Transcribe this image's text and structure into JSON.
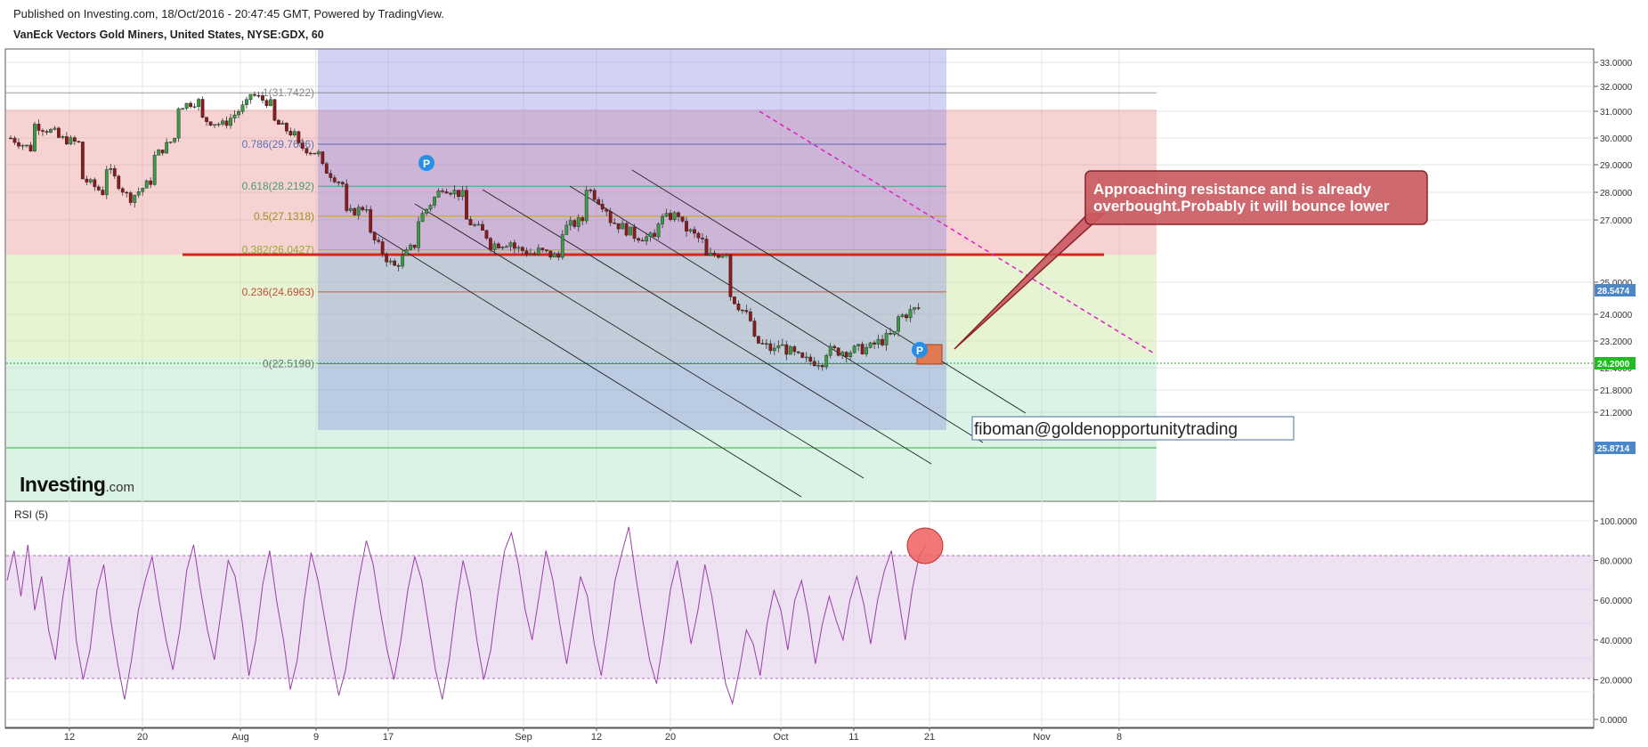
{
  "header": {
    "published": "Published on Investing.com, 18/Oct/2016 - 20:47:45 GMT, Powered by TradingView.",
    "symbol": "VanEck Vectors Gold Miners, United States, NYSE:GDX, 60"
  },
  "logo": {
    "brand": "Investing",
    "suffix": ".com"
  },
  "colors": {
    "bull": "#3a9a45",
    "bear": "#8b1a1a",
    "rsi": "#9b3ea8",
    "resistance": "#d7261e",
    "trend_dashed": "#e020c0",
    "channel": "#222222",
    "fib_box": "#8080e0"
  },
  "chart_data": [
    {
      "type": "candlestick",
      "title": "VanEck Vectors Gold Miners, United States, NYSE:GDX, 60",
      "x_ticks": [
        "12",
        "20",
        "Aug",
        "9",
        "17",
        "Sep",
        "12",
        "20",
        "Oct",
        "11",
        "21",
        "Nov",
        "8"
      ],
      "y_ticks": [
        "33.0000",
        "32.0000",
        "31.0000",
        "30.0000",
        "29.0000",
        "28.0000",
        "27.0000",
        "25.0000",
        "24.0000",
        "23.2000",
        "22.4000",
        "21.8000",
        "21.2000"
      ],
      "price_labels": [
        "28.5474",
        "24.2000",
        "25.8714"
      ],
      "y_range": [
        20.8,
        33.6
      ],
      "grid": true,
      "fibonacci": [
        {
          "label": "1(31.7422)",
          "level": 31.7422
        },
        {
          "label": "0.786(29.7686)",
          "level": 29.7686
        },
        {
          "label": "0.618(28.2192)",
          "level": 28.2192
        },
        {
          "label": "0.5(27.1318)",
          "level": 27.1318
        },
        {
          "label": "0.382(26.0427)",
          "level": 26.0427
        },
        {
          "label": "0.236(24.6963)",
          "level": 24.6963
        },
        {
          "label": "0(22.5198)",
          "level": 22.5198
        }
      ],
      "annotations": [
        {
          "text": "Approaching resistance and is already overbought.Probably it will bounce lower"
        },
        {
          "text": "fiboman@goldenopportunitytrading"
        },
        {
          "text": "P"
        },
        {
          "text": "P"
        }
      ],
      "close_path": [
        [
          30.0,
          29.6
        ],
        [
          30.5,
          30.2
        ],
        [
          30.0,
          29.8
        ],
        [
          28.5,
          28.0
        ],
        [
          28.9,
          27.9
        ],
        [
          27.8,
          28.4
        ],
        [
          29.3,
          30.0
        ],
        [
          31.2,
          31.4
        ],
        [
          30.7,
          30.5
        ],
        [
          30.6,
          31.3
        ],
        [
          31.7,
          31.3
        ],
        [
          30.6,
          30.1
        ],
        [
          29.7,
          29.4
        ],
        [
          28.9,
          28.3
        ],
        [
          27.2,
          27.5
        ],
        [
          26.5,
          25.6
        ],
        [
          25.5,
          26.2
        ],
        [
          27.0,
          28.0
        ],
        [
          28.2,
          27.9
        ],
        [
          27.0,
          26.5
        ],
        [
          26.2,
          26.3
        ],
        [
          26.1,
          25.9
        ],
        [
          26.0,
          25.8
        ],
        [
          26.7,
          27.0
        ],
        [
          28.2,
          27.4
        ],
        [
          27.0,
          26.6
        ],
        [
          26.5,
          26.4
        ],
        [
          27.0,
          27.2
        ],
        [
          26.8,
          26.3
        ],
        [
          25.8,
          26.0
        ],
        [
          24.6,
          23.8
        ],
        [
          23.2,
          22.9
        ],
        [
          23.1,
          22.7
        ],
        [
          22.6,
          22.6
        ],
        [
          22.9,
          22.9
        ],
        [
          22.9,
          23.0
        ],
        [
          23.1,
          23.4
        ],
        [
          23.9,
          24.2
        ]
      ]
    },
    {
      "type": "line",
      "title": "RSI (5)",
      "y_ticks": [
        "100.0000",
        "80.0000",
        "60.0000",
        "40.0000",
        "20.0000",
        "0.0000"
      ],
      "y_range": [
        0,
        100
      ],
      "levels": [
        80,
        20
      ],
      "series": [
        {
          "values": [
            70,
            85,
            62,
            88,
            55,
            72,
            45,
            30,
            60,
            82,
            40,
            20,
            35,
            65,
            78,
            50,
            28,
            10,
            30,
            55,
            70,
            82,
            60,
            40,
            25,
            45,
            75,
            88,
            65,
            45,
            30,
            55,
            80,
            72,
            50,
            22,
            40,
            68,
            85,
            60,
            40,
            15,
            30,
            60,
            84,
            70,
            50,
            30,
            12,
            25,
            50,
            72,
            90,
            78,
            55,
            35,
            20,
            40,
            65,
            82,
            70,
            48,
            25,
            10,
            30,
            58,
            80,
            65,
            40,
            20,
            35,
            62,
            85,
            94,
            78,
            55,
            40,
            62,
            85,
            70,
            48,
            28,
            50,
            72,
            62,
            38,
            22,
            45,
            70,
            84,
            97,
            72,
            50,
            30,
            18,
            40,
            65,
            80,
            60,
            38,
            55,
            78,
            62,
            40,
            18,
            8,
            25,
            45,
            38,
            22,
            48,
            65,
            55,
            35,
            60,
            70,
            52,
            28,
            48,
            62,
            50,
            40,
            60,
            72,
            58,
            38,
            60,
            75,
            85,
            62,
            40,
            65,
            82,
            88
          ]
        }
      ]
    }
  ]
}
